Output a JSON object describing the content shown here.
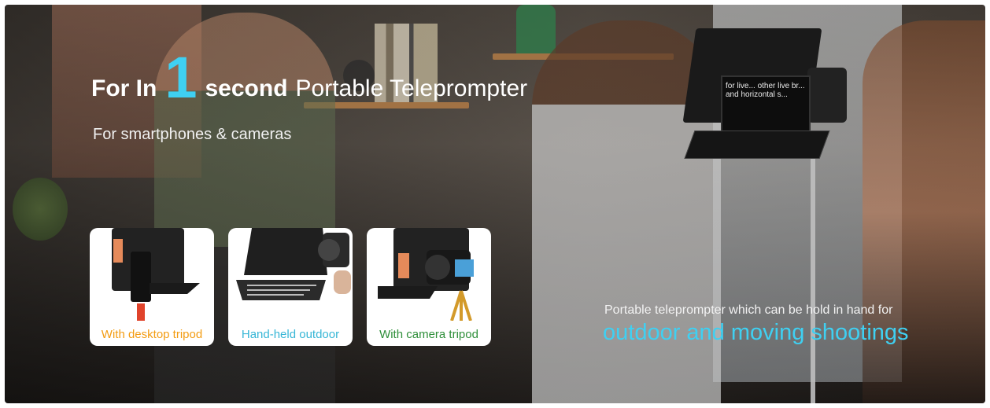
{
  "headline": {
    "part1": "For In",
    "number": "1",
    "part2": "second",
    "part3": "Portable Teleprompter"
  },
  "subheadline": "For smartphones & cameras",
  "prompter_screen_text": "for live... other live br... and horizontal s...",
  "cards": [
    {
      "label": "With desktop tripod",
      "label_color": "#f39c12"
    },
    {
      "label": "Hand-held outdoor",
      "label_color": "#36b6d6"
    },
    {
      "label": "With camera tripod",
      "label_color": "#2f8f3a"
    }
  ],
  "caption": {
    "small": "Portable teleprompter which can be hold in hand for",
    "large": "outdoor and moving shootings",
    "accent_color": "#3fd0f2"
  }
}
